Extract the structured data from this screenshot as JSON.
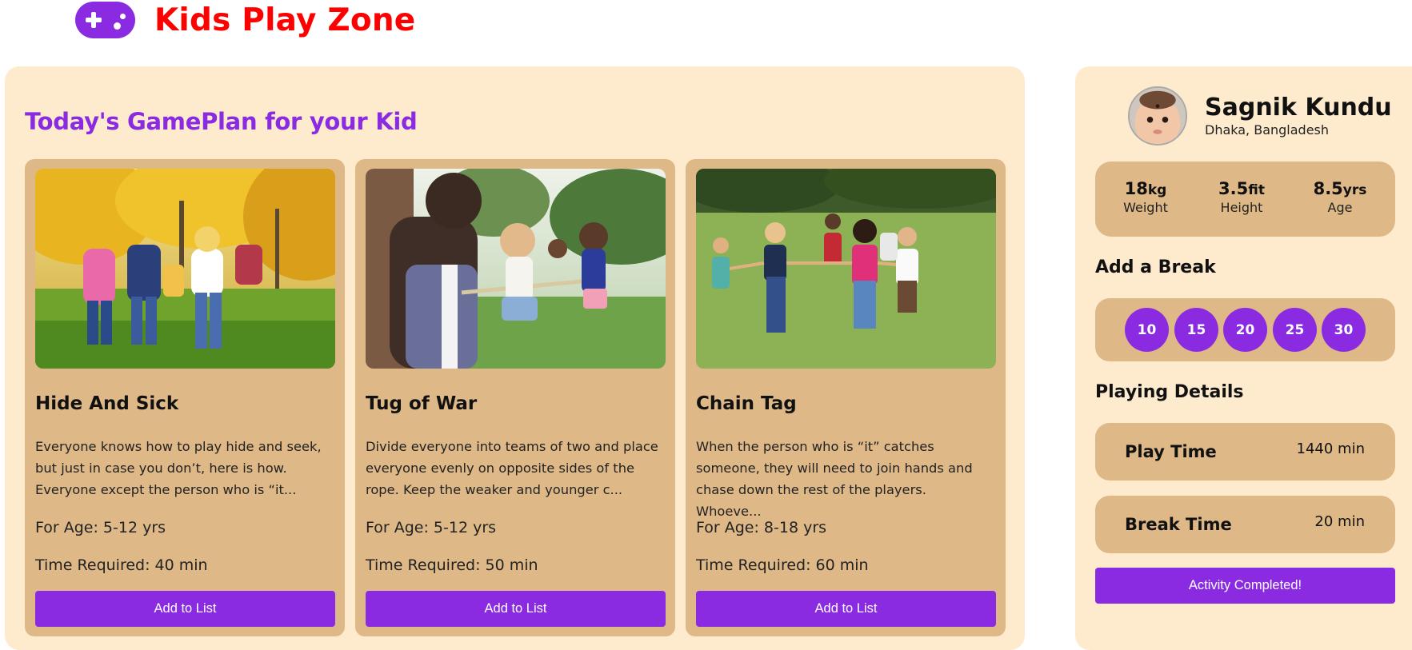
{
  "header": {
    "logo_icon": "gamepad-icon",
    "title": "Kids Play Zone"
  },
  "main": {
    "heading": "Today's GamePlan for your Kid",
    "cards": [
      {
        "image": "kids-hiding-in-autumn-park-photo",
        "title": "Hide And Sick",
        "description": "Everyone knows how to play hide and seek, but just in case you don’t, here is how. Everyone except the person who is “it...",
        "age": "For Age: 5-12 yrs",
        "time": "Time Required: 40 min",
        "button_label": "Add to List"
      },
      {
        "image": "kids-tug-of-war-photo",
        "title": "Tug of War",
        "description": "Divide everyone into teams of two and place everyone evenly on opposite sides of the rope. Keep the weaker and younger c...",
        "age": "For Age: 5-12 yrs",
        "time": "Time Required: 50 min",
        "button_label": "Add to List"
      },
      {
        "image": "kids-running-holding-hands-photo",
        "title": "Chain Tag",
        "description": "When the person who is “it” catches someone, they will need to join hands and chase down the rest of the players. Whoeve...",
        "age": "For Age: 8-18 yrs",
        "time": "Time Required: 60 min",
        "button_label": "Add to List"
      }
    ]
  },
  "sidebar": {
    "user": {
      "avatar": "baby-avatar-photo",
      "name": "Sagnik Kundu",
      "location": "Dhaka, Bangladesh"
    },
    "stats": [
      {
        "value": "18",
        "unit": "kg",
        "label": "Weight"
      },
      {
        "value": "3.5",
        "unit": "fit",
        "label": "Height"
      },
      {
        "value": "8.5",
        "unit": "yrs",
        "label": "Age"
      }
    ],
    "break_title": "Add a Break",
    "break_options": [
      "10",
      "15",
      "20",
      "25",
      "30"
    ],
    "details_title": "Playing Details",
    "play_time": {
      "label": "Play Time",
      "value": "1440 min"
    },
    "break_time": {
      "label": "Break Time",
      "value": "20 min"
    },
    "complete_label": "Activity Completed!"
  },
  "colors": {
    "accent": "#8a2be2",
    "title_red": "#ff0000",
    "panel_bg": "#feebcd",
    "card_bg": "#deb887"
  }
}
